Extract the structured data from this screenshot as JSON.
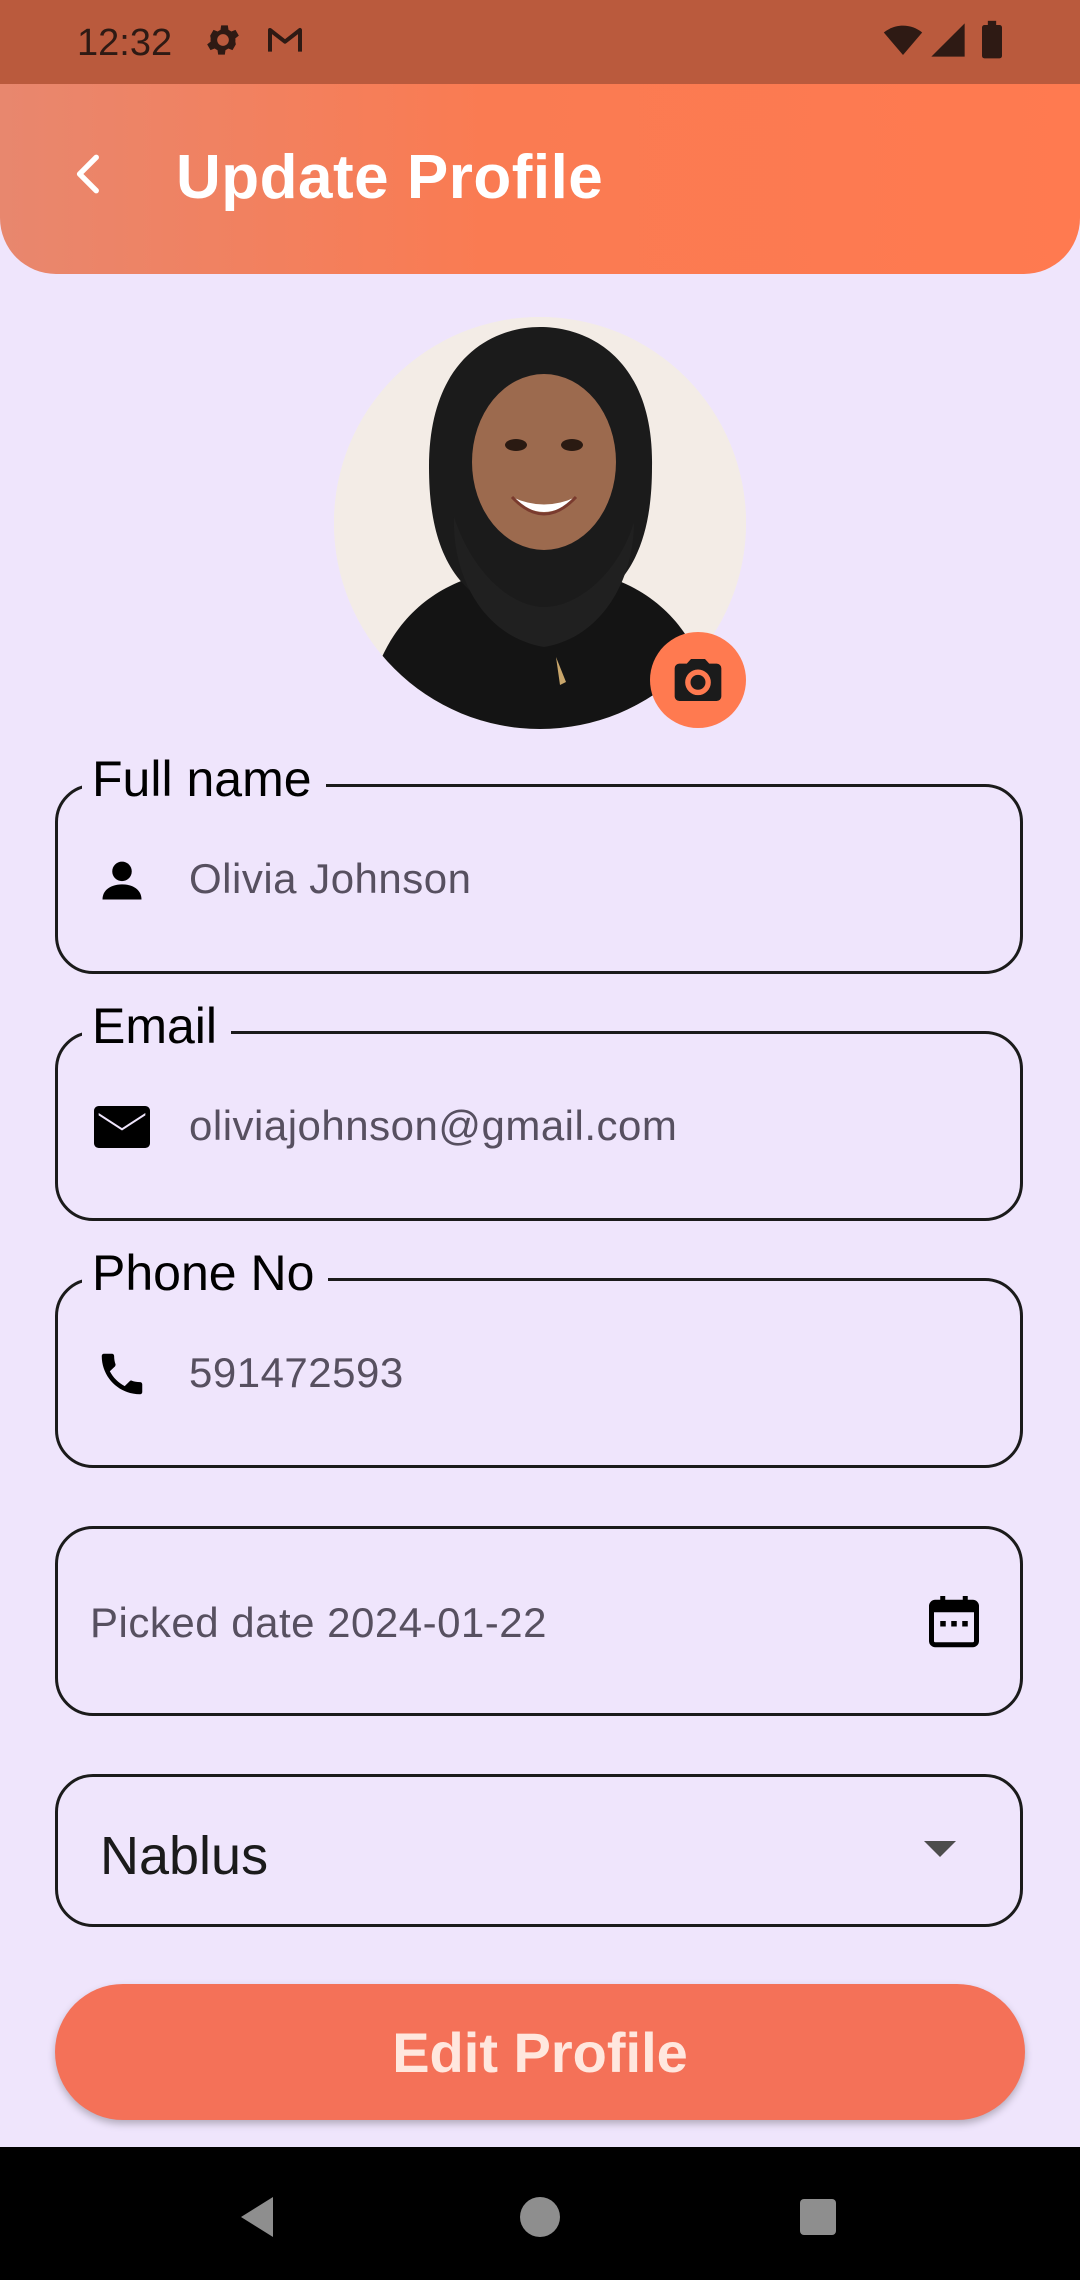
{
  "status_bar": {
    "time": "12:32",
    "icons": [
      "settings-gear-icon",
      "gmail-icon",
      "wifi-icon",
      "cellular-signal-icon",
      "battery-icon"
    ]
  },
  "app_bar": {
    "back_icon": "chevron-left-icon",
    "title": "Update Profile"
  },
  "profile": {
    "photo_description": "Smiling woman wearing a black hijab",
    "camera_icon": "camera-icon"
  },
  "form": {
    "full_name": {
      "label": "Full name",
      "value": "Olivia Johnson",
      "icon": "person-icon"
    },
    "email": {
      "label": "Email",
      "value": "oliviajohnson@gmail.com",
      "icon": "mail-icon"
    },
    "phone": {
      "label": "Phone No",
      "value": "591472593",
      "icon": "phone-icon"
    },
    "date": {
      "value": "Picked date 2024-01-22",
      "icon": "calendar-icon"
    },
    "city": {
      "selected": "Nablus"
    }
  },
  "edit_button": {
    "label": "Edit Profile"
  },
  "colors": {
    "accent": "#FF7A50",
    "button": "#F47158",
    "background": "#EFE5FC",
    "status_bar": "#BA5A3D"
  }
}
